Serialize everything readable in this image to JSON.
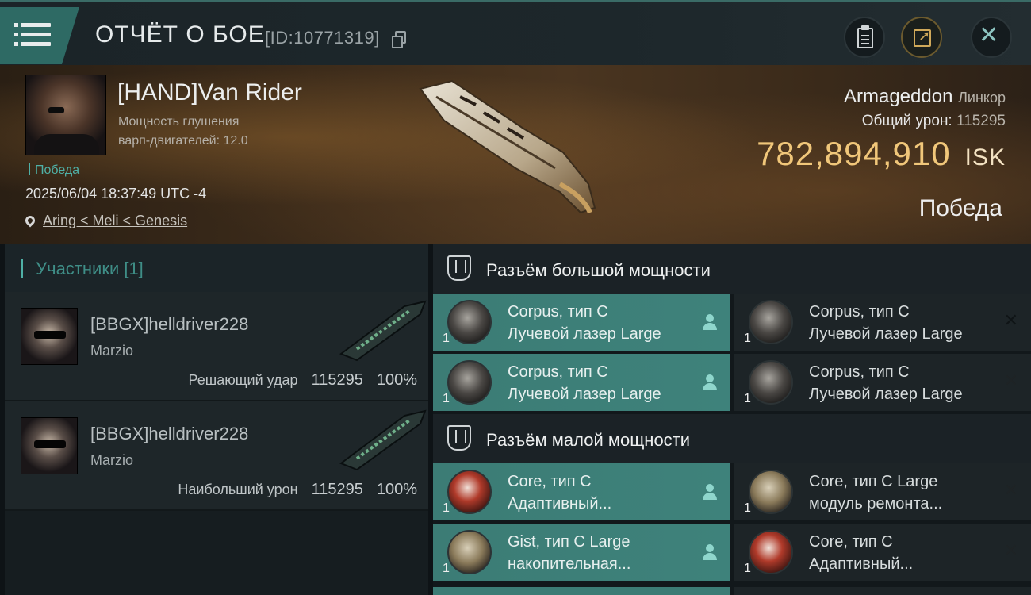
{
  "header": {
    "title": "ОТЧЁТ О БОЕ",
    "report_id": "[ID:10771319]",
    "buttons": {
      "menu": "menu-icon",
      "clipboard": "clipboard-icon",
      "share": "share-icon",
      "close": "close-icon"
    }
  },
  "victim": {
    "name": "[HAND]Van Rider",
    "warp_label_line1": "Мощность глушения",
    "warp_label_line2": "варп-двигателей: 12.0",
    "result_tag": "Победа",
    "timestamp": "2025/06/04 18:37:49 UTC -4",
    "location": "Aring < Meli < Genesis",
    "ship_name": "Armageddon",
    "ship_class": "Линкор",
    "total_damage_label": "Общий урон:",
    "total_damage_value": "115295",
    "isk_value": "782,894,910",
    "isk_currency": "ISK",
    "outcome": "Победа"
  },
  "participants": {
    "header": "Участники [1]",
    "rows": [
      {
        "name": "[BBGX]helldriver228",
        "corp": "Marzio",
        "role": "Решающий удар",
        "damage": "115295",
        "percent": "100%"
      },
      {
        "name": "[BBGX]helldriver228",
        "corp": "Marzio",
        "role": "Наибольший урон",
        "damage": "115295",
        "percent": "100%"
      }
    ]
  },
  "fittings": {
    "high_slots_title": "Разъём большой мощности",
    "mid_slots_title": "Разъём малой мощности",
    "high_slots": [
      {
        "name": "Corpus, тип C",
        "type": "Лучевой лазер Large",
        "qty": "1",
        "status": "fitted"
      },
      {
        "name": "Corpus, тип C",
        "type": "Лучевой лазер Large",
        "qty": "1",
        "status": "destroyed"
      },
      {
        "name": "Corpus, тип C",
        "type": "Лучевой лазер Large",
        "qty": "1",
        "status": "fitted"
      },
      {
        "name": "Corpus, тип C",
        "type": "Лучевой лазер Large",
        "qty": "1",
        "status": "destroyed"
      }
    ],
    "mid_slots": [
      {
        "name": "Core, тип C",
        "type": "Адаптивный...",
        "qty": "1",
        "status": "fitted"
      },
      {
        "name": "Core, тип C Large",
        "type": "модуль ремонта...",
        "qty": "1",
        "status": "destroyed"
      },
      {
        "name": "Gist, тип C Large",
        "type": "накопительная...",
        "qty": "1",
        "status": "fitted"
      },
      {
        "name": "Core, тип C",
        "type": "Адаптивный...",
        "qty": "1",
        "status": "destroyed"
      }
    ]
  },
  "colors": {
    "accent_teal": "#3e827b",
    "isk_gold": "#f1c77a",
    "win_green": "#4fb0a6"
  }
}
